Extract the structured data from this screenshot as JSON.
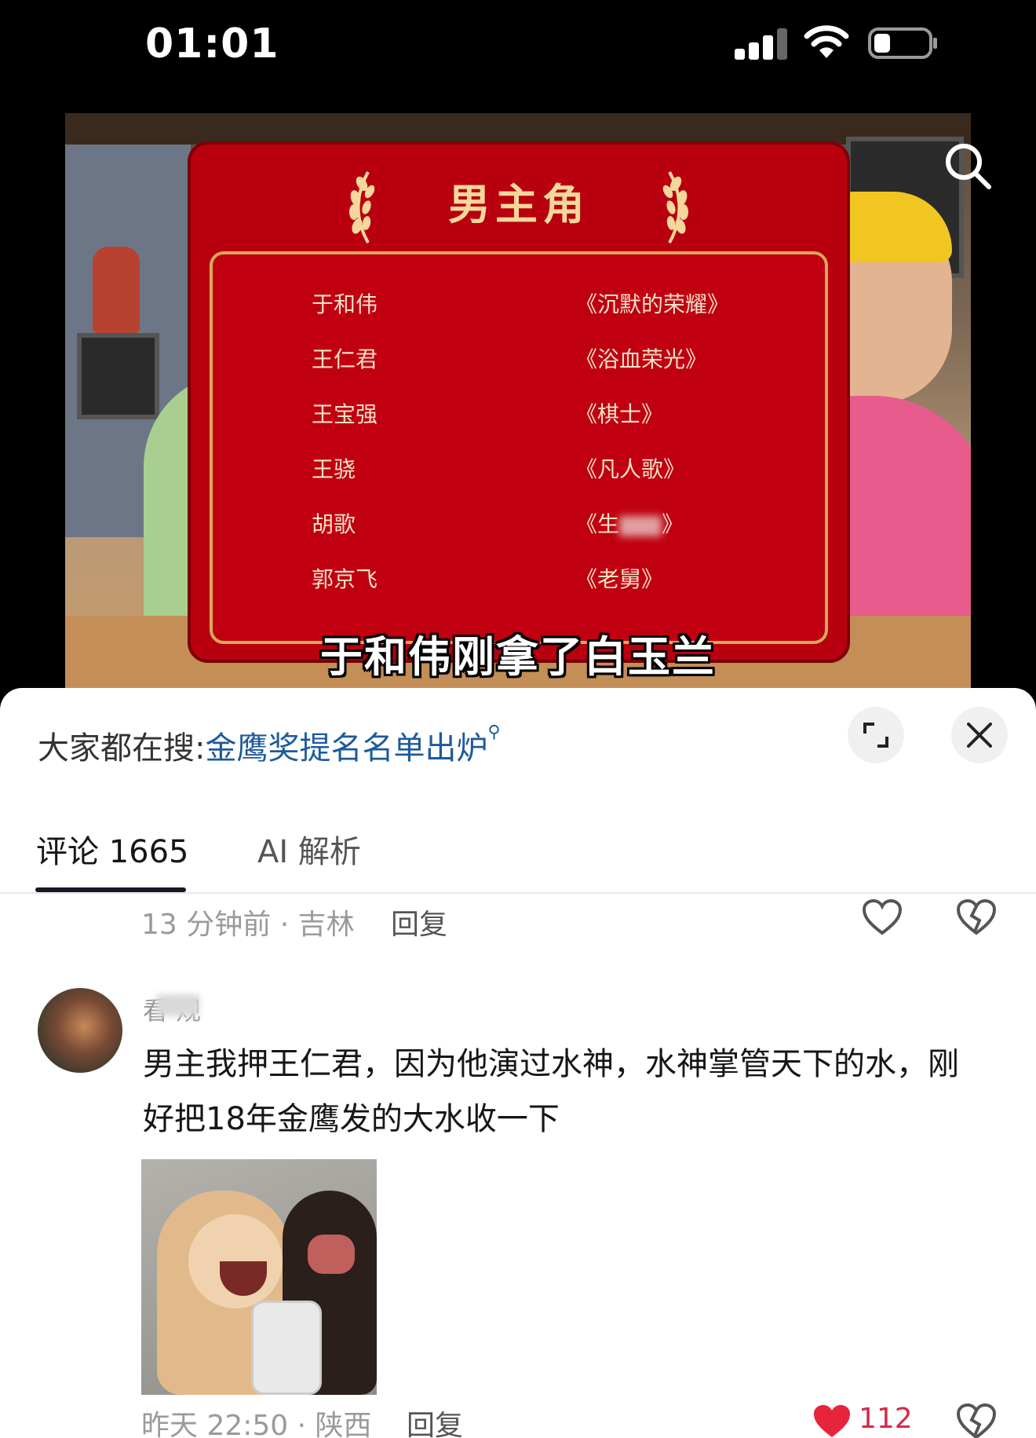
{
  "status_bar": {
    "time": "01:01"
  },
  "video": {
    "card_title": "男主角",
    "nominees": [
      {
        "name": "于和伟",
        "work": "《沉默的荣耀》"
      },
      {
        "name": "王仁君",
        "work": "《浴血荣光》"
      },
      {
        "name": "王宝强",
        "work": "《棋士》"
      },
      {
        "name": "王骁",
        "work": "《凡人歌》"
      },
      {
        "name": "胡歌",
        "work": "《生"
      },
      {
        "name": "郭京飞",
        "work": "《老舅》"
      }
    ],
    "nominee_work_suffix": "》",
    "subtitle": "于和伟刚拿了白玉兰"
  },
  "sheet": {
    "hot_search_prefix": "大家都在搜:",
    "hot_search_link": "金鹰奖提名名单出炉",
    "tabs": {
      "comments": "评论 1665",
      "ai": "AI 解析"
    },
    "prev_comment": {
      "meta": "13 分钟前 · 吉林",
      "reply": "回复"
    },
    "comment": {
      "username": "看 规",
      "text": "男主我押王仁君，因为他演过水神，水神掌管天下的水，刚好把18年金鹰发的大水收一下",
      "meta": "昨天 22:50 · 陕西",
      "reply": "回复",
      "likes": "112"
    }
  },
  "colors": {
    "link": "#1d5a9c",
    "like_red": "#d62a4a",
    "award_red": "#b8000f",
    "gold": "#f4d89b"
  }
}
